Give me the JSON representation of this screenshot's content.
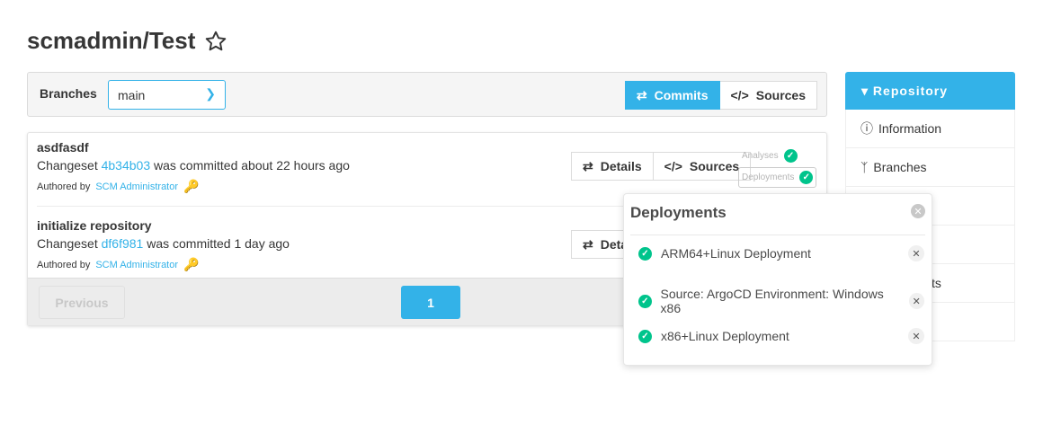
{
  "header": {
    "title": "scmadmin/Test",
    "star_icon": "star-outline-icon"
  },
  "toolbar": {
    "branches_label": "Branches",
    "branch_value": "main",
    "commits_label": "Commits",
    "sources_label": "Sources"
  },
  "commits": [
    {
      "title": "asdfasdf",
      "prefix": "Changeset",
      "id": "4b34b03",
      "middle": "was committed",
      "time": "about 22 hours ago",
      "authored_by": "Authored by",
      "author": "SCM Administrator"
    },
    {
      "title": "initialize repository",
      "prefix": "Changeset",
      "id": "df6f981",
      "middle": "was committed",
      "time": "1 day ago",
      "authored_by": "Authored by",
      "author": "SCM Administrator"
    }
  ],
  "commit_actions": {
    "details_label": "Details",
    "sources_label": "Sources",
    "details_label_partial": "Deta",
    "analyses": "Analyses",
    "deployments": "Deployments"
  },
  "pagination": {
    "previous": "Previous",
    "current": "1"
  },
  "sidebar": {
    "header": "Repository",
    "items": [
      {
        "label": "Information"
      },
      {
        "label": "Branches"
      },
      {
        "label": "sts"
      }
    ]
  },
  "popup": {
    "title": "Deployments",
    "items": [
      "ARM64+Linux Deployment",
      "Source: ArgoCD Environment: Windows x86",
      "x86+Linux Deployment"
    ]
  },
  "colors": {
    "accent": "#33b2e8",
    "success": "#00c48c"
  }
}
